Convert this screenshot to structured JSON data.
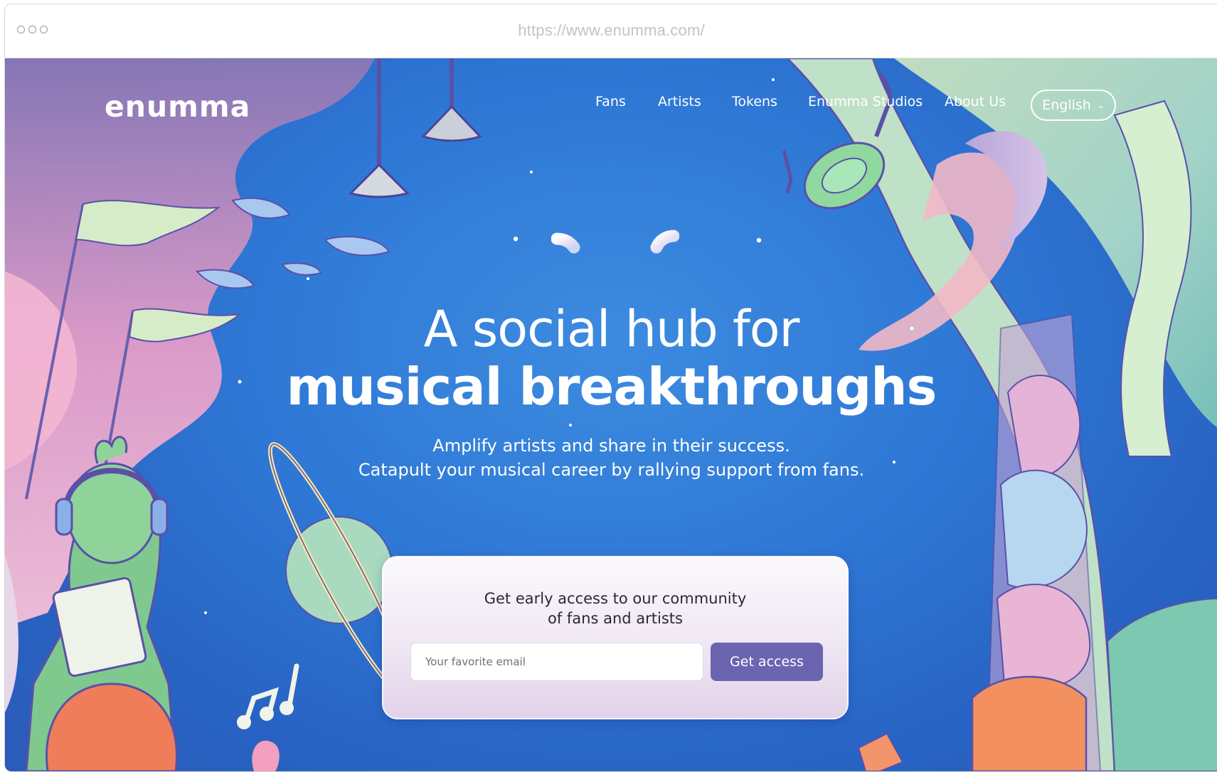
{
  "browser": {
    "url": "https://www.enumma.com/"
  },
  "header": {
    "logo": "enumma",
    "nav": [
      "Fans",
      "Artists",
      "Tokens",
      "Enumma Studios",
      "About Us"
    ],
    "language": "English"
  },
  "hero": {
    "headline_line1": "A social hub for",
    "headline_line2": "musical breakthroughs",
    "subline1": "Amplify artists and share in their success.",
    "subline2": "Catapult your musical career by rallying support from fans."
  },
  "signup": {
    "title_line1": "Get early access to our community",
    "title_line2": "of fans and artists",
    "email_placeholder": "Your favorite email",
    "button_label": "Get access"
  },
  "colors": {
    "background": "#2f79d6",
    "button": "#6b64b0",
    "text": "#ffffff"
  }
}
